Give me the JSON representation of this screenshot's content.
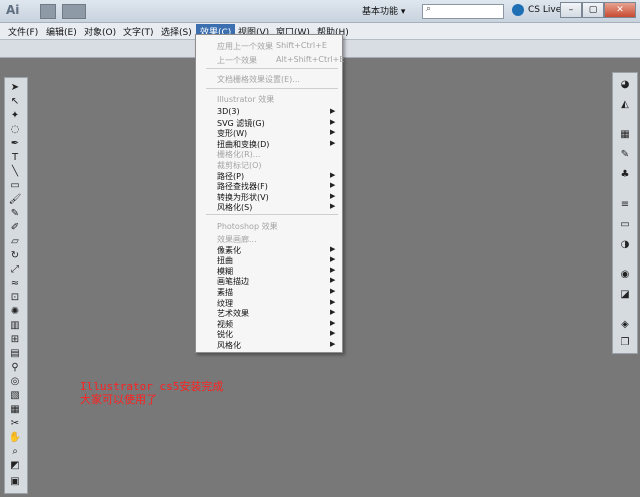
{
  "app": {
    "logo_text": "Ai"
  },
  "titlebar": {
    "workspace": "基本功能 ▾",
    "search_icon": "search-icon",
    "cslive": "CS Live ▾",
    "buttons": [
      "–",
      "▢",
      "✕"
    ]
  },
  "menubar": [
    "文件(F)",
    "编辑(E)",
    "对象(O)",
    "文字(T)",
    "选择(S)",
    "效果(C)",
    "视图(V)",
    "窗口(W)",
    "帮助(H)"
  ],
  "menu_effects": {
    "apply_last": {
      "label": "应用上一个效果",
      "shortcut": "Shift+Ctrl+E"
    },
    "last_effect": {
      "label": "上一个效果",
      "shortcut": "Alt+Shift+Ctrl+E"
    },
    "raster_settings": "文档栅格效果设置(E)...",
    "ai_header": "Illustrator 效果",
    "ai_items": [
      {
        "label": "3D(3)",
        "submenu": true,
        "disabled": false
      },
      {
        "label": "SVG 滤镜(G)",
        "submenu": true,
        "disabled": false
      },
      {
        "label": "变形(W)",
        "submenu": true,
        "disabled": false
      },
      {
        "label": "扭曲和变换(D)",
        "submenu": true,
        "disabled": false
      },
      {
        "label": "栅格化(R)...",
        "submenu": false,
        "disabled": true
      },
      {
        "label": "裁剪标记(O)",
        "submenu": false,
        "disabled": true
      },
      {
        "label": "路径(P)",
        "submenu": true,
        "disabled": false
      },
      {
        "label": "路径查找器(F)",
        "submenu": true,
        "disabled": false
      },
      {
        "label": "转换为形状(V)",
        "submenu": true,
        "disabled": false
      },
      {
        "label": "风格化(S)",
        "submenu": true,
        "disabled": false
      }
    ],
    "ps_header": "Photoshop 效果",
    "ps_items": [
      {
        "label": "效果画廊...",
        "submenu": false,
        "disabled": true
      },
      {
        "label": "像素化",
        "submenu": true,
        "disabled": false
      },
      {
        "label": "扭曲",
        "submenu": true,
        "disabled": false
      },
      {
        "label": "模糊",
        "submenu": true,
        "disabled": false
      },
      {
        "label": "画笔描边",
        "submenu": true,
        "disabled": false
      },
      {
        "label": "素描",
        "submenu": true,
        "disabled": false
      },
      {
        "label": "纹理",
        "submenu": true,
        "disabled": false
      },
      {
        "label": "艺术效果",
        "submenu": true,
        "disabled": false
      },
      {
        "label": "视频",
        "submenu": true,
        "disabled": false
      },
      {
        "label": "锐化",
        "submenu": true,
        "disabled": false
      },
      {
        "label": "风格化",
        "submenu": true,
        "disabled": false
      }
    ]
  },
  "note": {
    "line1": "Illustrator cs5安装完成",
    "line2": "大家可以使用了"
  },
  "left_tools": [
    "selection-icon",
    "direct-selection-icon",
    "magic-wand-icon",
    "lasso-icon",
    "pen-icon",
    "type-icon",
    "line-icon",
    "rectangle-icon",
    "paintbrush-icon",
    "pencil-icon",
    "blob-brush-icon",
    "eraser-icon",
    "rotate-icon",
    "scale-icon",
    "warp-icon",
    "free-transform-icon",
    "symbol-sprayer-icon",
    "graph-icon",
    "mesh-icon",
    "gradient-icon",
    "eyedropper-icon",
    "blend-icon",
    "live-paint-icon",
    "artboard-icon",
    "slice-icon",
    "hand-icon",
    "zoom-icon",
    "fill-stroke-icon",
    "screen-mode-icon"
  ],
  "right_panels": [
    "color-icon",
    "color-guide-icon",
    "swatches-icon",
    "brushes-icon",
    "symbols-icon",
    "stroke-icon",
    "gradient-panel-icon",
    "transparency-icon",
    "appearance-icon",
    "graphic-styles-icon",
    "layers-icon",
    "artboards-panel-icon"
  ]
}
